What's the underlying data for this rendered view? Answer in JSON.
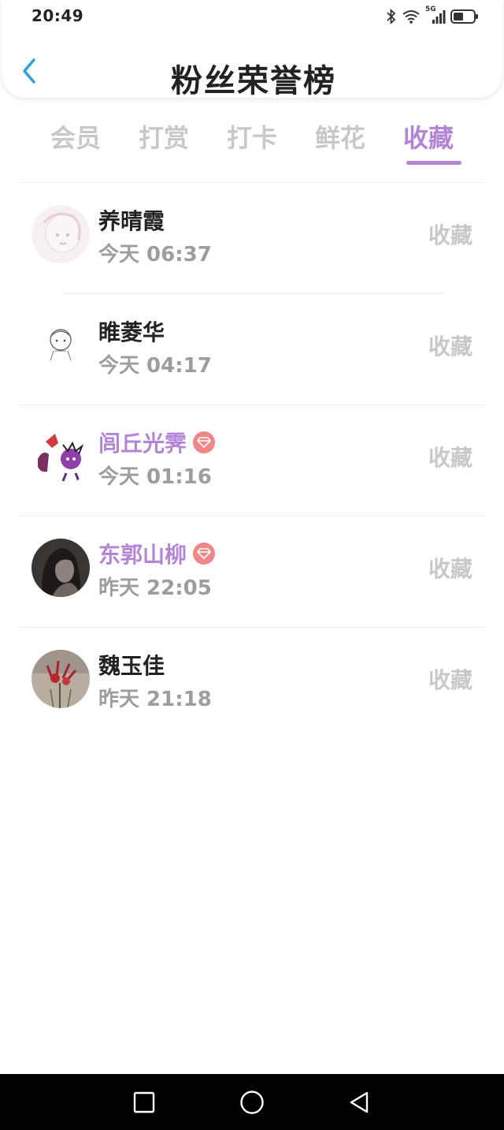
{
  "status_bar": {
    "time": "20:49",
    "network_label": "5G",
    "icons": [
      "bluetooth-icon",
      "wifi-icon",
      "signal-icon",
      "battery-icon"
    ]
  },
  "header": {
    "title": "粉丝荣誉榜",
    "back_icon": "chevron-left-icon"
  },
  "tabs": [
    {
      "label": "会员",
      "active": false
    },
    {
      "label": "打赏",
      "active": false
    },
    {
      "label": "打卡",
      "active": false
    },
    {
      "label": "鲜花",
      "active": false
    },
    {
      "label": "收藏",
      "active": true
    }
  ],
  "colors": {
    "accent": "#b485d6",
    "vip_badge": "#f08787",
    "muted": "#c8c8c8",
    "time_text": "#9d9d9d"
  },
  "fans": [
    {
      "name": "养晴霞",
      "time": "今天 06:37",
      "action": "收藏",
      "vip": false
    },
    {
      "name": "睢菱华",
      "time": "今天 04:17",
      "action": "收藏",
      "vip": false
    },
    {
      "name": "闾丘光霁",
      "time": "今天 01:16",
      "action": "收藏",
      "vip": true
    },
    {
      "name": "东郭山柳",
      "time": "昨天 22:05",
      "action": "收藏",
      "vip": true
    },
    {
      "name": "魏玉佳",
      "time": "昨天 21:18",
      "action": "收藏",
      "vip": false
    }
  ],
  "nav_bar": {
    "icons": [
      "recents-square-icon",
      "home-circle-icon",
      "back-triangle-icon"
    ]
  }
}
